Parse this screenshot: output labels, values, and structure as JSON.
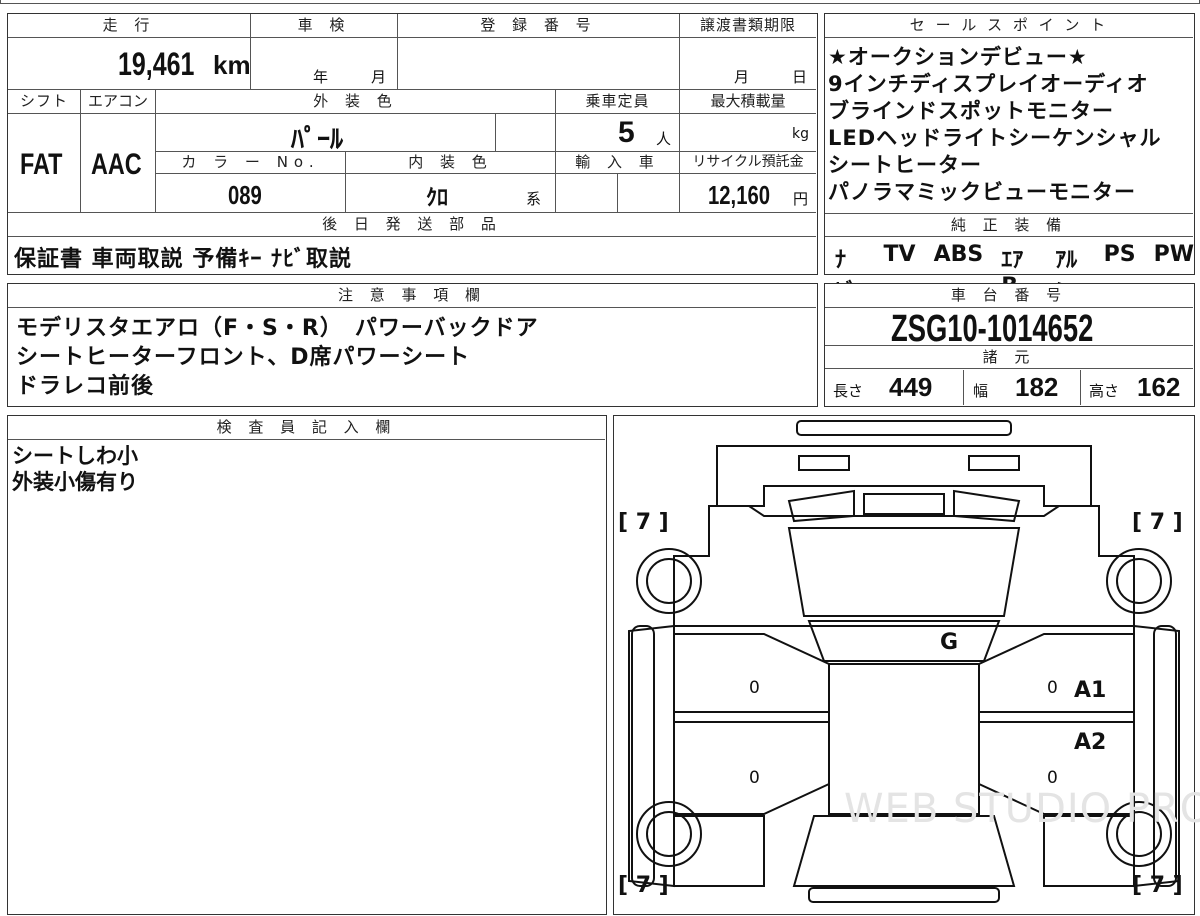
{
  "headers": {
    "mileage": "走 行",
    "inspection": "車 検",
    "registration": "登 録 番 号",
    "transfer_deadline": "譲渡書類期限",
    "shift": "シフト",
    "aircon": "エアコン",
    "exterior_color": "外 装 色",
    "capacity": "乗車定員",
    "max_load": "最大積載量",
    "color_no": "カ ラ ー No.",
    "interior_color": "内 装 色",
    "import": "輸 入 車",
    "recycle": "リサイクル預託金",
    "later_items": "後 日 発 送 部 品",
    "sales_points": "セ ー ル ス ポ イ ン ト",
    "genuine_equipment": "純 正 装 備",
    "notes": "注 意 事 項 欄",
    "chassis_no": "車 台 番 号",
    "specs": "諸 元",
    "inspector": "検 査 員 記 入 欄"
  },
  "values": {
    "mileage": "19,461",
    "mileage_unit": "km",
    "inspection_year": "年",
    "inspection_month": "月",
    "transfer_month": "月",
    "transfer_day": "日",
    "shift": "FAT",
    "aircon": "AAC",
    "exterior_color": "ﾊﾟｰﾙ",
    "capacity": "5",
    "capacity_unit": "人",
    "max_load_unit": "kg",
    "color_no": "089",
    "interior_color": "ｸﾛ",
    "interior_suffix": "系",
    "recycle": "12,160",
    "recycle_unit": "円",
    "later_items": "保証書 車両取説 予備ｷｰ ﾅﾋﾞ取説",
    "chassis_no": "ZSG10-1014652",
    "length_label": "長さ",
    "length": "449",
    "width_label": "幅",
    "width": "182",
    "height_label": "高さ",
    "height": "162"
  },
  "sales_points": [
    "★オークションデビュー★",
    "9インチディスプレイオーディオ",
    "ブラインドスポットモニター",
    "LEDヘッドライトシーケンシャル",
    "シートヒーター",
    "パノラマミックビューモニター"
  ],
  "equipment": [
    "ﾅﾋﾞ",
    "TV",
    "ABS",
    "ｴｱB",
    "ｱﾙﾐ",
    "PS",
    "PW"
  ],
  "notes": [
    "モデリスタエアロ（F・S・R）　パワーバックドア",
    "シートヒーターフロント、D席パワーシート",
    "ドラレコ前後"
  ],
  "inspector_notes": [
    "シートしわ小",
    "外装小傷有り"
  ],
  "diagram": {
    "tires": [
      "[ 7 ]",
      "[ 7 ]",
      "[ 7 ]",
      "[ 7 ]"
    ],
    "marks": [
      "G",
      "A1",
      "A2"
    ],
    "zeros": [
      "0",
      "0",
      "0",
      "0"
    ]
  },
  "watermark": "WEB STUDIO PRO"
}
